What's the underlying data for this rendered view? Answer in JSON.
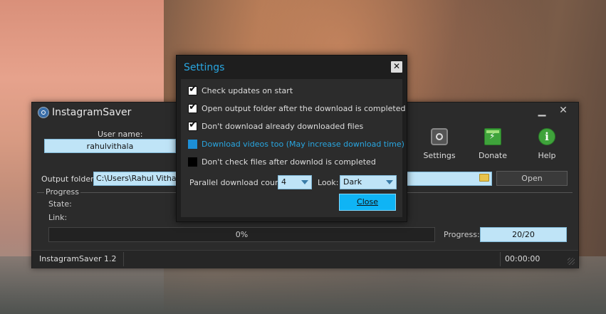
{
  "app": {
    "title": "InstagramSaver",
    "username_label": "User name:",
    "username_value": "rahulvithala",
    "toolbar": {
      "settings_label": "Settings",
      "donate_label": "Donate",
      "help_label": "Help"
    },
    "output_folder_label": "Output folder:",
    "output_folder_value": "C:\\Users\\Rahul Vithala\\",
    "open_label": "Open",
    "progress_group_title": "Progress",
    "state_label": "State:",
    "link_label": "Link:",
    "progress_percent": "0%",
    "progress_label": "Progress:",
    "progress_count": "20/20",
    "status_version": "InstagramSaver 1.2",
    "status_time": "00:00:00"
  },
  "settings": {
    "title": "Settings",
    "options": [
      {
        "label": "Check updates on start",
        "checked": true
      },
      {
        "label": "Open output folder after the download is completed",
        "checked": true
      },
      {
        "label": "Don't download already downloaded files",
        "checked": true
      },
      {
        "label": "Download videos too (May increase download time)",
        "checked": false
      },
      {
        "label": "Don't check files after downlod is completed",
        "checked": false
      }
    ],
    "parallel_label": "Parallel download count:",
    "parallel_value": "4",
    "look_label": "Look:",
    "look_value": "Dark",
    "close_label": "Close"
  },
  "colors": {
    "accent": "#29a6e0",
    "field_bg": "#bfe4f7",
    "window_bg": "#2b2b2b"
  }
}
